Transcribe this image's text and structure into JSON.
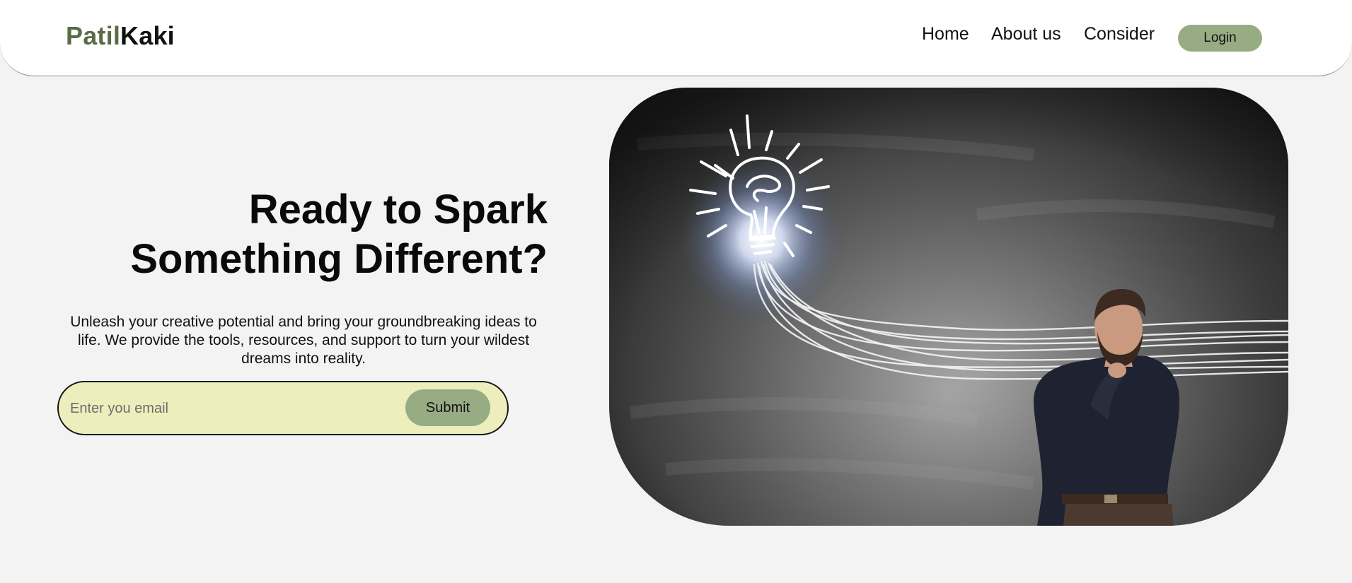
{
  "header": {
    "brand_part1": "Patil",
    "brand_part2": "Kaki",
    "nav": {
      "home": "Home",
      "about": "About us",
      "consider": "Consider",
      "login": "Login"
    }
  },
  "hero": {
    "title_line1": "Ready to Spark",
    "title_line2": "Something Different?",
    "description": "Unleash your creative potential and bring your groundbreaking ideas to life. We provide the tools, resources, and support to turn your wildest dreams into reality.",
    "email_placeholder": "Enter you email",
    "submit_label": "Submit"
  },
  "colors": {
    "brand_green": "#5a6b48",
    "button_green": "#98ac84",
    "input_bg": "#eeeebd",
    "page_bg": "#f3f3f3"
  },
  "image": {
    "subject": "chalkboard-lightbulb-with-thinking-man"
  }
}
